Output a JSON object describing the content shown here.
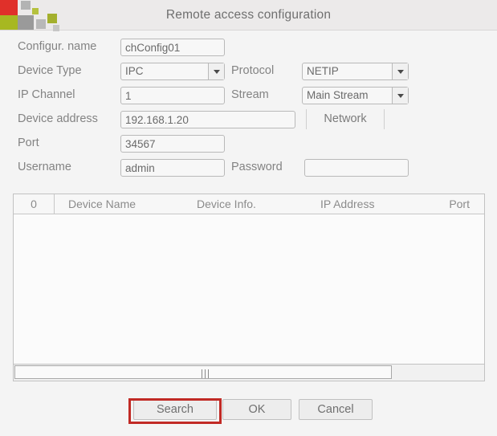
{
  "window": {
    "title": "Remote access configuration",
    "logo_colors": [
      "#e0302a",
      "#a7b821",
      "#9a9a9a",
      "#b3b3b3",
      "#b5c13e",
      "#b8b8b8",
      "#a4b02e",
      "#c6c6c6"
    ],
    "background": "#f4f4f4"
  },
  "form": {
    "config_name": {
      "label": "Configur. name",
      "value": "chConfig01"
    },
    "device_type": {
      "label": "Device Type",
      "value": "IPC",
      "icon": "chevron-down-icon"
    },
    "protocol": {
      "label": "Protocol",
      "value": "NETIP",
      "icon": "chevron-down-icon"
    },
    "ip_channel": {
      "label": "IP Channel",
      "value": "1"
    },
    "stream": {
      "label": "Stream",
      "value": "Main Stream",
      "icon": "chevron-down-icon"
    },
    "device_address": {
      "label": "Device address",
      "value": "192.168.1.20"
    },
    "network_button": {
      "label": "Network"
    },
    "port": {
      "label": "Port",
      "value": "34567"
    },
    "username": {
      "label": "Username",
      "value": "admin"
    },
    "password": {
      "label": "Password",
      "value": "",
      "placeholder": ""
    }
  },
  "table": {
    "columns": {
      "index": "0",
      "device_name": "Device Name",
      "device_info": "Device Info.",
      "ip_address": "IP Address",
      "port": "Port"
    },
    "rows": []
  },
  "footer": {
    "search": "Search",
    "ok": "OK",
    "cancel": "Cancel",
    "highlight_color": "#c12a25",
    "highlighted_button": "Search"
  }
}
